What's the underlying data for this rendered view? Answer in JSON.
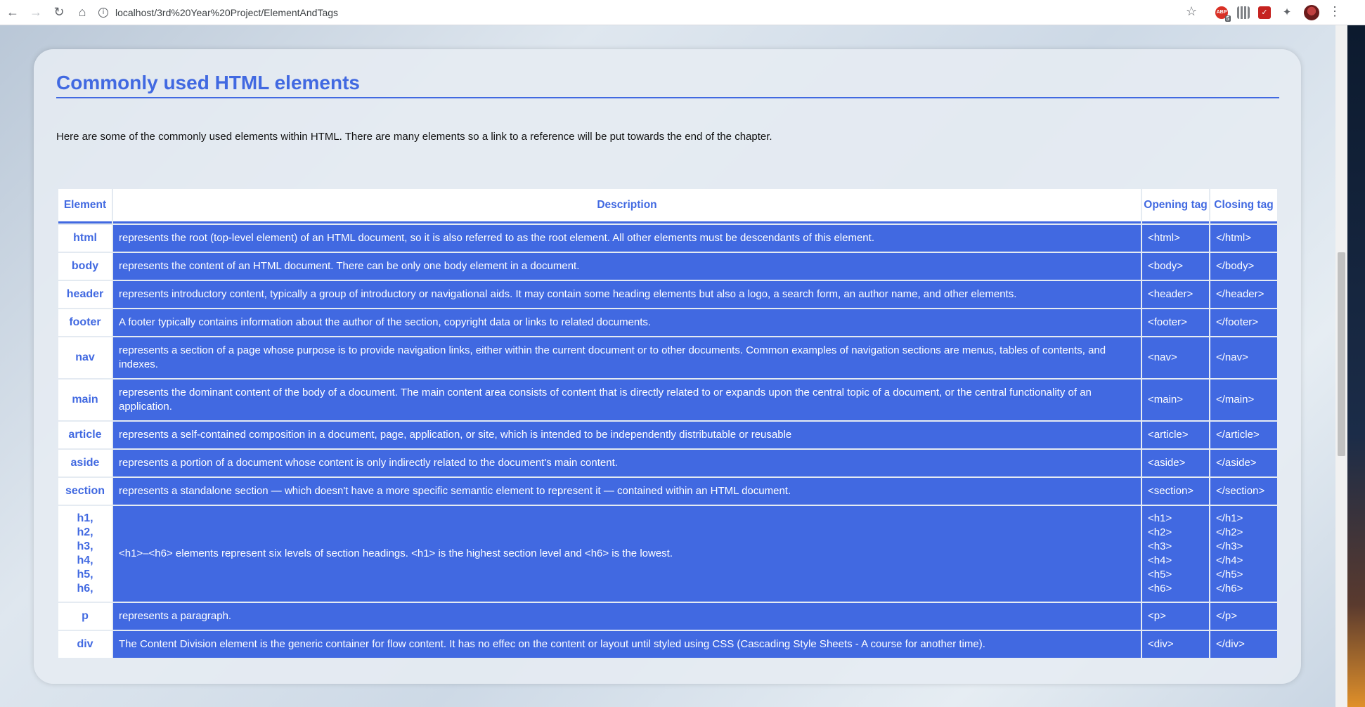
{
  "browser": {
    "url": "localhost/3rd%20Year%20Project/ElementAndTags",
    "back_icon": "arrow-left",
    "forward_icon": "arrow-right",
    "reload_icon": "reload",
    "home_icon": "home",
    "extension_badge_count": "5",
    "abp_label": "ABP"
  },
  "page": {
    "title": "Commonly used HTML elements",
    "intro": "Here are some of the commonly used elements within HTML. There are many elements so a link to a reference will be put towards the end of the chapter.",
    "accent_color": "#4169e1"
  },
  "table": {
    "headers": {
      "element": "Element",
      "description": "Description",
      "opening": "Opening tag",
      "closing": "Closing tag"
    },
    "rows": [
      {
        "element": "html",
        "description": "represents the root (top-level element) of an HTML document, so it is also referred to as the root element. All other elements must be descendants of this element.",
        "open": "<html>",
        "close": "</html>"
      },
      {
        "element": "body",
        "description": "represents the content of an HTML document. There can be only one body element in a document.",
        "open": "<body>",
        "close": "</body>"
      },
      {
        "element": "header",
        "description": "represents introductory content, typically a group of introductory or navigational aids. It may contain some heading elements but also a logo, a search form, an author name, and other elements.",
        "open": "<header>",
        "close": "</header>"
      },
      {
        "element": "footer",
        "description": "A footer typically contains information about the author of the section, copyright data or links to related documents.",
        "open": "<footer>",
        "close": "</footer>"
      },
      {
        "element": "nav",
        "description": "represents a section of a page whose purpose is to provide navigation links, either within the current document or to other documents. Common examples of navigation sections are menus, tables of contents, and indexes.",
        "open": "<nav>",
        "close": "</nav>"
      },
      {
        "element": "main",
        "description": "represents the dominant content of the body of a document. The main content area consists of content that is directly related to or expands upon the central topic of a document, or the central functionality of an application.",
        "open": "<main>",
        "close": "</main>"
      },
      {
        "element": "article",
        "description": "represents a self-contained composition in a document, page, application, or site, which is intended to be independently distributable or reusable",
        "open": "<article>",
        "close": "</article>"
      },
      {
        "element": "aside",
        "description": "represents a portion of a document whose content is only indirectly related to the document's main content.",
        "open": "<aside>",
        "close": "</aside>"
      },
      {
        "element": "section",
        "description": "represents a standalone section — which doesn't have a more specific semantic element to represent it — contained within an HTML document.",
        "open": "<section>",
        "close": "</section>"
      },
      {
        "element_lines": [
          "h1,",
          "h2,",
          "h3,",
          "h4,",
          "h5,",
          "h6,"
        ],
        "description": "<h1>–<h6> elements represent six levels of section headings. <h1> is the highest section level and <h6> is the lowest.",
        "open_lines": [
          "<h1>",
          "<h2>",
          "<h3>",
          "<h4>",
          "<h5>",
          "<h6>"
        ],
        "close_lines": [
          "</h1>",
          "</h2>",
          "</h3>",
          "</h4>",
          "</h5>",
          "</h6>"
        ]
      },
      {
        "element": "p",
        "description": "represents a paragraph.",
        "open": "<p>",
        "close": "</p>"
      },
      {
        "element": "div",
        "description": "The Content Division element is the generic container for flow content. It has no effec on the content or layout until styled using CSS (Cascading Style Sheets - A course for another time).",
        "open": "<div>",
        "close": "</div>"
      }
    ]
  }
}
